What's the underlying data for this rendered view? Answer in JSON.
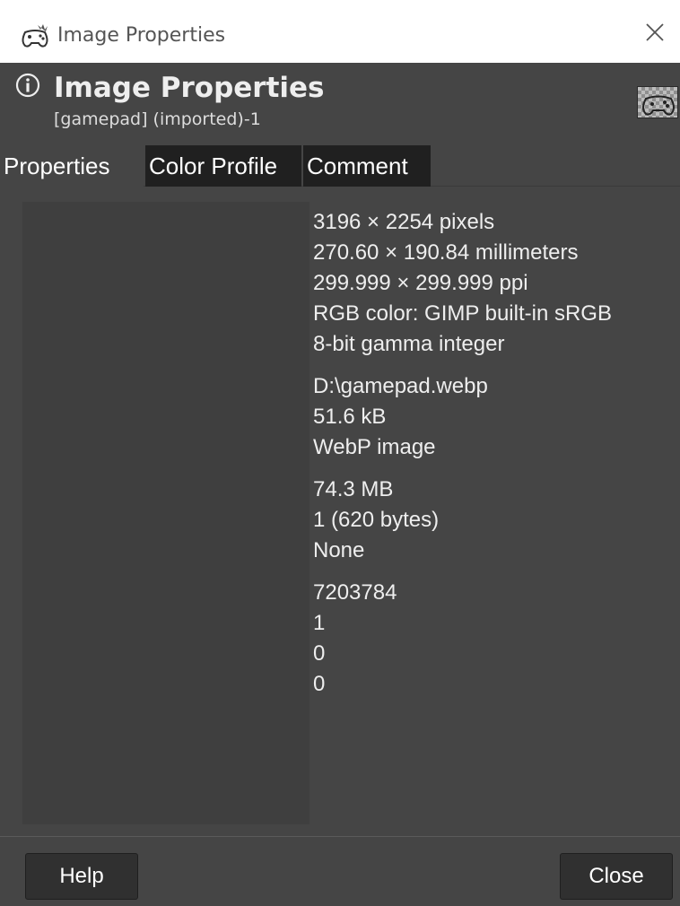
{
  "window": {
    "title": "Image Properties",
    "app_icon": "gamepad-icon",
    "close_icon": "close-icon"
  },
  "header": {
    "icon": "info-icon",
    "title": "Image Properties",
    "subtitle": "[gamepad] (imported)-1",
    "thumbnail_icon": "gamepad-thumbnail"
  },
  "tabs": [
    {
      "label": "Properties",
      "active": true
    },
    {
      "label": "Color Profile",
      "active": false
    },
    {
      "label": "Comment",
      "active": false
    }
  ],
  "properties": {
    "groups": [
      [
        "3196 × 2254 pixels",
        "270.60 × 190.84 millimeters",
        "299.999 × 299.999 ppi",
        "RGB color: GIMP built-in sRGB",
        "8-bit gamma integer"
      ],
      [
        "D:\\gamepad.webp",
        "51.6 kB",
        "WebP image"
      ],
      [
        "74.3 MB",
        "1 (620 bytes)",
        "None"
      ],
      [
        "7203784",
        "1",
        "0",
        "0"
      ]
    ]
  },
  "buttons": {
    "help": "Help",
    "close": "Close"
  },
  "colors": {
    "dialog_bg": "#454545",
    "tab_inactive_bg": "#202020",
    "label_column_bg": "#3f3f3f",
    "button_bg": "#303030"
  }
}
